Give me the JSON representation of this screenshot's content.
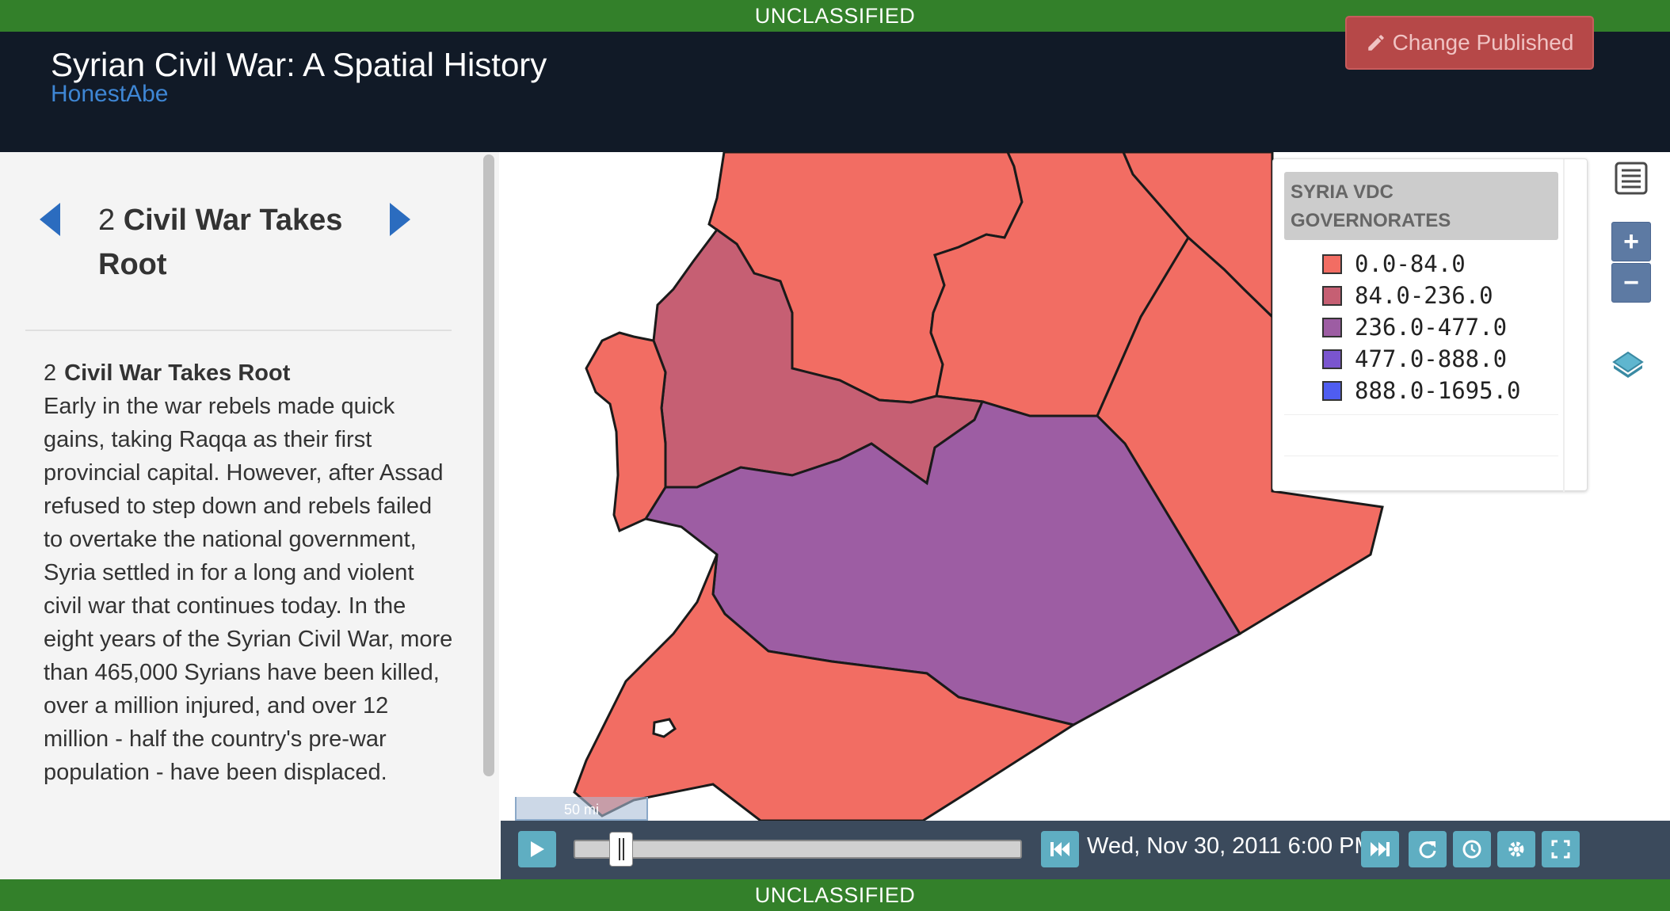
{
  "classification": {
    "top": "UNCLASSIFIED",
    "bottom": "UNCLASSIFIED"
  },
  "header": {
    "title": "Syrian Civil War: A Spatial History",
    "author": "HonestAbe",
    "change_button": "Change Published"
  },
  "chapter_nav": {
    "number": "2",
    "title": "Civil War Takes Root"
  },
  "content": {
    "number": "2",
    "heading": "Civil War Takes Root",
    "body": "Early in the war rebels made quick gains, taking Raqqa as their first provincial capital. However, after Assad refused to step down and rebels failed to overtake the national government, Syria settled in for a long and violent civil war that continues today. In the eight years of the Syrian Civil War, more than 465,000 Syrians have been killed, over a million injured, and over 12 million - half the country's pre-war population - have been displaced."
  },
  "legend": {
    "title": "SYRIA VDC GOVERNORATES",
    "items": [
      {
        "label": "0.0-84.0",
        "color": "#f26d63"
      },
      {
        "label": "84.0-236.0",
        "color": "#c65f73"
      },
      {
        "label": "236.0-477.0",
        "color": "#9d5da3"
      },
      {
        "label": "477.0-888.0",
        "color": "#7a55cf"
      },
      {
        "label": "888.0-1695.0",
        "color": "#4f5df0"
      }
    ]
  },
  "map": {
    "scale_label": "50 mi"
  },
  "timeline": {
    "datetime": "Wed, Nov 30, 2011 6:00 PM",
    "position": 0.08
  },
  "colors": {
    "classification_bar": "#33802a",
    "header_bg": "#111a27",
    "author_link": "#3e86d4",
    "nav_arrow": "#2b6cbf",
    "timebar_bg": "#3b4a5c",
    "timebar_button": "#5faec2",
    "map_tool_button": "#5d7aa3"
  }
}
